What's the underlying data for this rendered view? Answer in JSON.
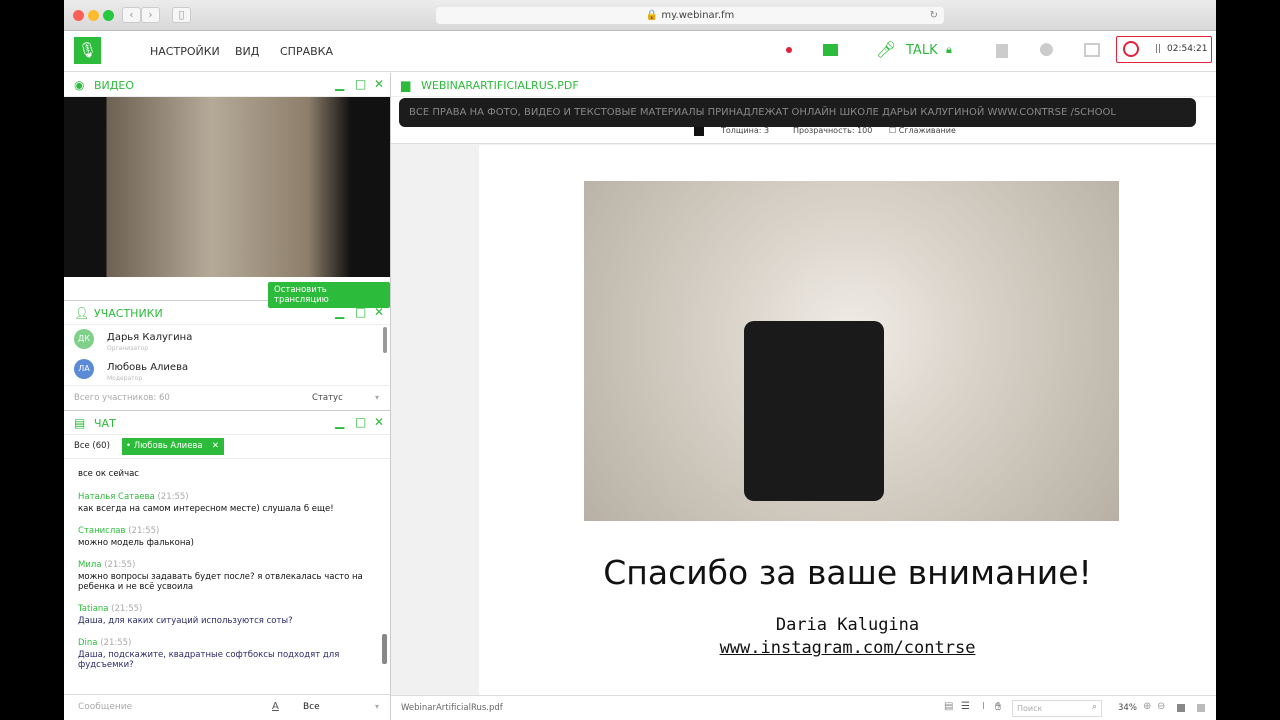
{
  "browser": {
    "url": "my.webinar.fm"
  },
  "menu": {
    "settings": "НАСТРОЙКИ",
    "view": "ВИД",
    "help": "СПРАВКА"
  },
  "toolbar": {
    "talk": "TALK",
    "timer": "02:54:21"
  },
  "video": {
    "title": "ВИДЕО",
    "stop": "Остановить трансляцию"
  },
  "participants": {
    "title": "УЧАСТНИКИ",
    "items": [
      {
        "initials": "ДК",
        "name": "Дарья Калугина",
        "role": "Организатор"
      },
      {
        "initials": "ЛА",
        "name": "Любовь Алиева",
        "role": "Модератор"
      }
    ],
    "total": "Всего участников: 60",
    "status": "Статус"
  },
  "chat": {
    "title": "ЧАТ",
    "tab_all": "Все (60)",
    "tab_private": "• Любовь Алиева",
    "partial": "все ок сейчас",
    "messages": [
      {
        "name": "Наталья Сатаева",
        "time": "(21:55)",
        "text": "как всегда на самом интересном месте) слушала б еще!"
      },
      {
        "name": "Станислав",
        "time": "(21:55)",
        "text": "можно модель фалькона)"
      },
      {
        "name": "Мила",
        "time": "(21:55)",
        "text": "можно вопросы задавать будет после? я отвлекалась часто на ребенка и не всё усвоила"
      },
      {
        "name": "Tatiana",
        "time": "(21:55)",
        "text": "Даша, для каких ситуаций используются соты?"
      },
      {
        "name": "Dina",
        "time": "(21:55)",
        "text": "Даша, подскажите, квадратные софтбоксы подходят для фудсъемки?"
      }
    ],
    "input_placeholder": "Сообщение",
    "recipient": "Все"
  },
  "doc": {
    "title": "WEBINARARTIFICIALRUS.PDF",
    "banner": "ВСЕ ПРАВА НА ФОТО, ВИДЕО И ТЕКСТОВЫЕ МАТЕРИАЛЫ ПРИНАДЛЕЖАТ ОНЛАЙН ШКОЛЕ ДАРЬИ КАЛУГИНОЙ WWW.CONTRSE /SCHOOL",
    "thickness": "Толщина: 3",
    "opacity": "Прозрачность: 100",
    "smoothing": "Сглаживание",
    "slide_heading": "Спасибо за ваше внимание!",
    "slide_name": "Daria Kalugina",
    "slide_link": "www.instagram.com/contrse",
    "filename": "WebinarArtificialRus.pdf",
    "search_placeholder": "Поиск",
    "zoom": "34%"
  }
}
